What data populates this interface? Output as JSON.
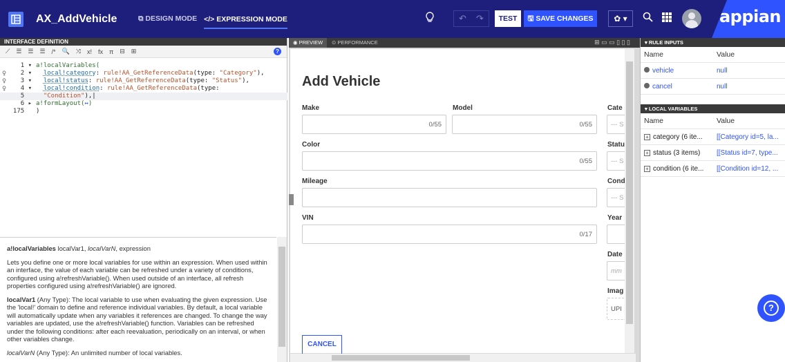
{
  "app": {
    "title": "AX_AddVehicle",
    "design_mode": "DESIGN MODE",
    "expression_mode": "</> EXPRESSION MODE",
    "brand": "appian"
  },
  "toolbar": {
    "test": "TEST",
    "save": "SAVE CHANGES",
    "undo": "↶",
    "redo": "↷",
    "gear": "✿ ▾"
  },
  "left": {
    "section_title": "INTERFACE DEFINITION",
    "tools": [
      "⟋",
      "☰",
      "☰",
      "☰",
      "/*",
      "🔍",
      "⤨",
      "x!",
      "fx",
      "π",
      "⊟",
      "⊞"
    ],
    "help": "?",
    "lines": [
      {
        "num": "1",
        "fold": "▾",
        "parts": [
          {
            "t": "a!localVariables(",
            "c": "kw"
          }
        ]
      },
      {
        "num": "2",
        "fold": "▾",
        "bulb": true,
        "parts": [
          {
            "t": "  "
          },
          {
            "t": "local!category",
            "c": "var"
          },
          {
            "t": ": "
          },
          {
            "t": "rule!AA_GetReferenceData",
            "c": "rl"
          },
          {
            "t": "(type: "
          },
          {
            "t": "\"Category\"",
            "c": "str"
          },
          {
            "t": "),"
          }
        ]
      },
      {
        "num": "3",
        "fold": "▾",
        "bulb": true,
        "parts": [
          {
            "t": "  "
          },
          {
            "t": "local!status",
            "c": "var"
          },
          {
            "t": ": "
          },
          {
            "t": "rule!AA_GetReferenceData",
            "c": "rl"
          },
          {
            "t": "(type: "
          },
          {
            "t": "\"Status\"",
            "c": "str"
          },
          {
            "t": "),"
          }
        ]
      },
      {
        "num": "4",
        "fold": "▾",
        "bulb": true,
        "parts": [
          {
            "t": "  "
          },
          {
            "t": "local!condition",
            "c": "var"
          },
          {
            "t": ": "
          },
          {
            "t": "rule!AA_GetReferenceData",
            "c": "rl"
          },
          {
            "t": "(type:"
          }
        ]
      },
      {
        "num": "5",
        "fold": "",
        "hl": true,
        "parts": [
          {
            "t": "  "
          },
          {
            "t": "\"Condition\"",
            "c": "str"
          },
          {
            "t": "),|"
          }
        ]
      },
      {
        "num": "6",
        "fold": "▸",
        "parts": [
          {
            "t": "a!formLayout(",
            "c": "kw"
          },
          {
            "t": "↔",
            "c": "blue"
          },
          {
            "t": ")",
            "c": "kw"
          }
        ]
      },
      {
        "num": "175",
        "fold": "",
        "parts": [
          {
            "t": ")"
          }
        ]
      }
    ],
    "docs": {
      "signature_name": "a!localVariables",
      "signature_rest": " localVar1, ",
      "signature_italic": "localVarN",
      "signature_end": ", expression",
      "p1": "Lets you define one or more local variables for use within an expression. When used within an interface, the value of each variable can be refreshed under a variety of conditions, configured using a!refreshVariable(). When used outside of an interface, all refresh properties configured using a!refreshVariable() are ignored.",
      "p2_name": "localVar1",
      "p2": " (Any Type): The local variable to use when evaluating the given expression. Use the 'local!' domain to define and reference individual variables. By default, a local variable will automatically update when any variables it references are changed. To change the way variables are updated, use the a!refreshVariable() function. Variables can be refreshed under the following conditions: after each reevaluation, periodically on an interval, or when other variables change.",
      "p3_name": "localVarN",
      "p3": " (Any Type): An unlimited number of local variables."
    }
  },
  "mid": {
    "tab_preview": "◉ PREVIEW",
    "tab_performance": "⊙ PERFORMANCE",
    "devices": "⊞ ▭ ▭ ▯ ▯ ▯",
    "form": {
      "title": "Add Vehicle",
      "make": "Make",
      "make_count": "0/55",
      "model": "Model",
      "model_count": "0/55",
      "category": "Cate",
      "color": "Color",
      "color_count": "0/55",
      "status": "Statu",
      "mileage": "Mileage",
      "condition": "Cond",
      "vin": "VIN",
      "vin_count": "0/17",
      "year": "Year",
      "date": "Date",
      "date_ph": "mm",
      "image": "Imag",
      "upload": "UPI",
      "select_ph": "--- S",
      "cancel": "CANCEL"
    }
  },
  "right": {
    "rule_inputs": "▾ RULE INPUTS",
    "local_variables": "▾ LOCAL VARIABLES",
    "col_name": "Name",
    "col_value": "Value",
    "inputs": [
      {
        "name": "vehicle",
        "value": "null"
      },
      {
        "name": "cancel",
        "value": "null"
      }
    ],
    "locals": [
      {
        "name": "category (6 ite...",
        "value": "[[Category id=5, la..."
      },
      {
        "name": "status (3 items)",
        "value": "[[Status id=7, type..."
      },
      {
        "name": "condition (6 ite...",
        "value": "[[Condition id=12, ..."
      }
    ]
  }
}
